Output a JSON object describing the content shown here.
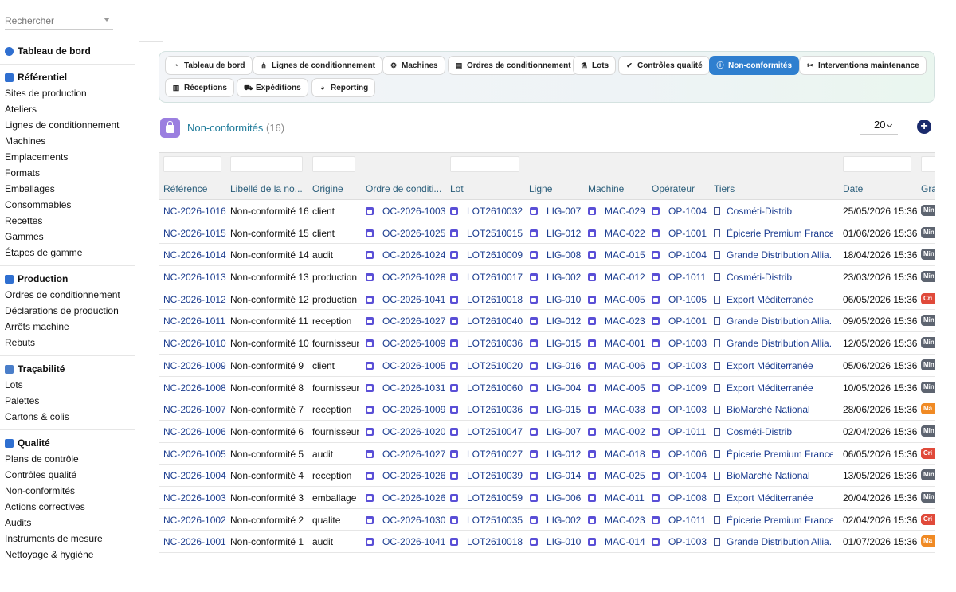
{
  "search": {
    "placeholder": "Rechercher"
  },
  "sidebar": {
    "dashboard": "Tableau de bord",
    "sections": [
      {
        "title": "Référentiel",
        "color": "#2f6fd0",
        "items": [
          "Sites de production",
          "Ateliers",
          "Lignes de conditionnement",
          "Machines",
          "Emplacements",
          "Formats",
          "Emballages",
          "Consommables",
          "Recettes",
          "Gammes",
          "Étapes de gamme"
        ]
      },
      {
        "title": "Production",
        "color": "#2f6fd0",
        "items": [
          "Ordres de conditionnement",
          "Déclarations de production",
          "Arrêts machine",
          "Rebuts"
        ]
      },
      {
        "title": "Traçabilité",
        "color": "#4a7ec9",
        "items": [
          "Lots",
          "Palettes",
          "Cartons & colis"
        ]
      },
      {
        "title": "Qualité",
        "color": "#2f6fd0",
        "items": [
          "Plans de contrôle",
          "Contrôles qualité",
          "Non-conformités",
          "Actions correctives",
          "Audits",
          "Instruments de mesure",
          "Nettoyage & hygiène"
        ]
      }
    ]
  },
  "tabs": [
    {
      "label": "Tableau de bord",
      "icon": "dashboard-icon",
      "glyph": "◔"
    },
    {
      "label": "Lignes de conditionnement",
      "icon": "network-icon",
      "glyph": "⋔"
    },
    {
      "label": "Machines",
      "icon": "gears-icon",
      "glyph": "⚙"
    },
    {
      "label": "Ordres de conditionnement",
      "icon": "clipboard-icon",
      "glyph": "▤"
    },
    {
      "label": "Lots",
      "icon": "flask-icon",
      "glyph": "⚗"
    },
    {
      "label": "Contrôles qualité",
      "icon": "check-circle-icon",
      "glyph": "✔"
    },
    {
      "label": "Non-conformités",
      "icon": "info-circle-icon",
      "glyph": "ⓘ"
    },
    {
      "label": "Interventions maintenance",
      "icon": "tools-icon",
      "glyph": "✂"
    },
    {
      "label": "Réceptions",
      "icon": "dolly-icon",
      "glyph": "▥"
    },
    {
      "label": "Expéditions",
      "icon": "truck-icon",
      "glyph": "⛟"
    },
    {
      "label": "Reporting",
      "icon": "chart-pie-icon",
      "glyph": "◕"
    }
  ],
  "active_tab": "Non-conformités",
  "header": {
    "title": "Non-conformités",
    "count": "(16)",
    "page_size": "20",
    "add_label": "+"
  },
  "columns": [
    "Référence",
    "Libellé de la no...",
    "Origine",
    "Ordre de conditi...",
    "Lot",
    "Ligne",
    "Machine",
    "Opérateur",
    "Tiers",
    "Date",
    "Gra"
  ],
  "rows": [
    {
      "ref": "NC-2026-1016",
      "label": "Non-conformité 16",
      "origin": "client",
      "order": "OC-2026-1003",
      "lot": "LOT2610032",
      "line": "LIG-007",
      "machine": "MAC-029",
      "operator": "OP-1004",
      "tiers": "Cosméti-Distrib",
      "date": "25/05/2026 15:36",
      "grav": "Min",
      "grav_color": "#5d6470"
    },
    {
      "ref": "NC-2026-1015",
      "label": "Non-conformité 15",
      "origin": "client",
      "order": "OC-2026-1025",
      "lot": "LOT2510015",
      "line": "LIG-012",
      "machine": "MAC-022",
      "operator": "OP-1001",
      "tiers": "Épicerie Premium France",
      "date": "01/06/2026 15:36",
      "grav": "Min",
      "grav_color": "#5d6470"
    },
    {
      "ref": "NC-2026-1014",
      "label": "Non-conformité 14",
      "origin": "audit",
      "order": "OC-2026-1024",
      "lot": "LOT2610009",
      "line": "LIG-008",
      "machine": "MAC-015",
      "operator": "OP-1004",
      "tiers": "Grande Distribution Allia...",
      "date": "18/04/2026 15:36",
      "grav": "Min",
      "grav_color": "#5d6470"
    },
    {
      "ref": "NC-2026-1013",
      "label": "Non-conformité 13",
      "origin": "production",
      "order": "OC-2026-1028",
      "lot": "LOT2610017",
      "line": "LIG-002",
      "machine": "MAC-012",
      "operator": "OP-1011",
      "tiers": "Cosméti-Distrib",
      "date": "23/03/2026 15:36",
      "grav": "Min",
      "grav_color": "#5d6470"
    },
    {
      "ref": "NC-2026-1012",
      "label": "Non-conformité 12",
      "origin": "production",
      "order": "OC-2026-1041",
      "lot": "LOT2610018",
      "line": "LIG-010",
      "machine": "MAC-005",
      "operator": "OP-1005",
      "tiers": "Export Méditerranée",
      "date": "06/05/2026 15:36",
      "grav": "Cri",
      "grav_color": "#e04a3a"
    },
    {
      "ref": "NC-2026-1011",
      "label": "Non-conformité 11",
      "origin": "reception",
      "order": "OC-2026-1027",
      "lot": "LOT2610040",
      "line": "LIG-012",
      "machine": "MAC-023",
      "operator": "OP-1001",
      "tiers": "Grande Distribution Allia...",
      "date": "09/05/2026 15:36",
      "grav": "Min",
      "grav_color": "#5d6470"
    },
    {
      "ref": "NC-2026-1010",
      "label": "Non-conformité 10",
      "origin": "fournisseur",
      "order": "OC-2026-1009",
      "lot": "LOT2610036",
      "line": "LIG-015",
      "machine": "MAC-001",
      "operator": "OP-1003",
      "tiers": "Grande Distribution Allia...",
      "date": "12/05/2026 15:36",
      "grav": "Min",
      "grav_color": "#5d6470"
    },
    {
      "ref": "NC-2026-1009",
      "label": "Non-conformité 9",
      "origin": "client",
      "order": "OC-2026-1005",
      "lot": "LOT2510020",
      "line": "LIG-016",
      "machine": "MAC-006",
      "operator": "OP-1003",
      "tiers": "Export Méditerranée",
      "date": "05/06/2026 15:36",
      "grav": "Min",
      "grav_color": "#5d6470"
    },
    {
      "ref": "NC-2026-1008",
      "label": "Non-conformité 8",
      "origin": "fournisseur",
      "order": "OC-2026-1031",
      "lot": "LOT2610060",
      "line": "LIG-004",
      "machine": "MAC-005",
      "operator": "OP-1009",
      "tiers": "Export Méditerranée",
      "date": "10/05/2026 15:36",
      "grav": "Min",
      "grav_color": "#5d6470"
    },
    {
      "ref": "NC-2026-1007",
      "label": "Non-conformité 7",
      "origin": "reception",
      "order": "OC-2026-1009",
      "lot": "LOT2610036",
      "line": "LIG-015",
      "machine": "MAC-038",
      "operator": "OP-1003",
      "tiers": "BioMarché National",
      "date": "28/06/2026 15:36",
      "grav": "Ma",
      "grav_color": "#f08a24"
    },
    {
      "ref": "NC-2026-1006",
      "label": "Non-conformité 6",
      "origin": "fournisseur",
      "order": "OC-2026-1020",
      "lot": "LOT2510047",
      "line": "LIG-007",
      "machine": "MAC-002",
      "operator": "OP-1011",
      "tiers": "Cosméti-Distrib",
      "date": "02/04/2026 15:36",
      "grav": "Min",
      "grav_color": "#5d6470"
    },
    {
      "ref": "NC-2026-1005",
      "label": "Non-conformité 5",
      "origin": "audit",
      "order": "OC-2026-1027",
      "lot": "LOT2610027",
      "line": "LIG-012",
      "machine": "MAC-018",
      "operator": "OP-1006",
      "tiers": "Épicerie Premium France",
      "date": "06/05/2026 15:36",
      "grav": "Cri",
      "grav_color": "#e04a3a"
    },
    {
      "ref": "NC-2026-1004",
      "label": "Non-conformité 4",
      "origin": "reception",
      "order": "OC-2026-1026",
      "lot": "LOT2610039",
      "line": "LIG-014",
      "machine": "MAC-025",
      "operator": "OP-1004",
      "tiers": "BioMarché National",
      "date": "13/05/2026 15:36",
      "grav": "Min",
      "grav_color": "#5d6470"
    },
    {
      "ref": "NC-2026-1003",
      "label": "Non-conformité 3",
      "origin": "emballage",
      "order": "OC-2026-1026",
      "lot": "LOT2610059",
      "line": "LIG-006",
      "machine": "MAC-011",
      "operator": "OP-1008",
      "tiers": "Export Méditerranée",
      "date": "20/04/2026 15:36",
      "grav": "Min",
      "grav_color": "#5d6470"
    },
    {
      "ref": "NC-2026-1002",
      "label": "Non-conformité 2",
      "origin": "qualite",
      "order": "OC-2026-1030",
      "lot": "LOT2510035",
      "line": "LIG-002",
      "machine": "MAC-023",
      "operator": "OP-1011",
      "tiers": "Épicerie Premium France",
      "date": "02/04/2026 15:36",
      "grav": "Cri",
      "grav_color": "#e04a3a"
    },
    {
      "ref": "NC-2026-1001",
      "label": "Non-conformité 1",
      "origin": "audit",
      "order": "OC-2026-1041",
      "lot": "LOT2610018",
      "line": "LIG-010",
      "machine": "MAC-014",
      "operator": "OP-1003",
      "tiers": "Grande Distribution Allia...",
      "date": "01/07/2026 15:36",
      "grav": "Ma",
      "grav_color": "#f08a24"
    }
  ]
}
